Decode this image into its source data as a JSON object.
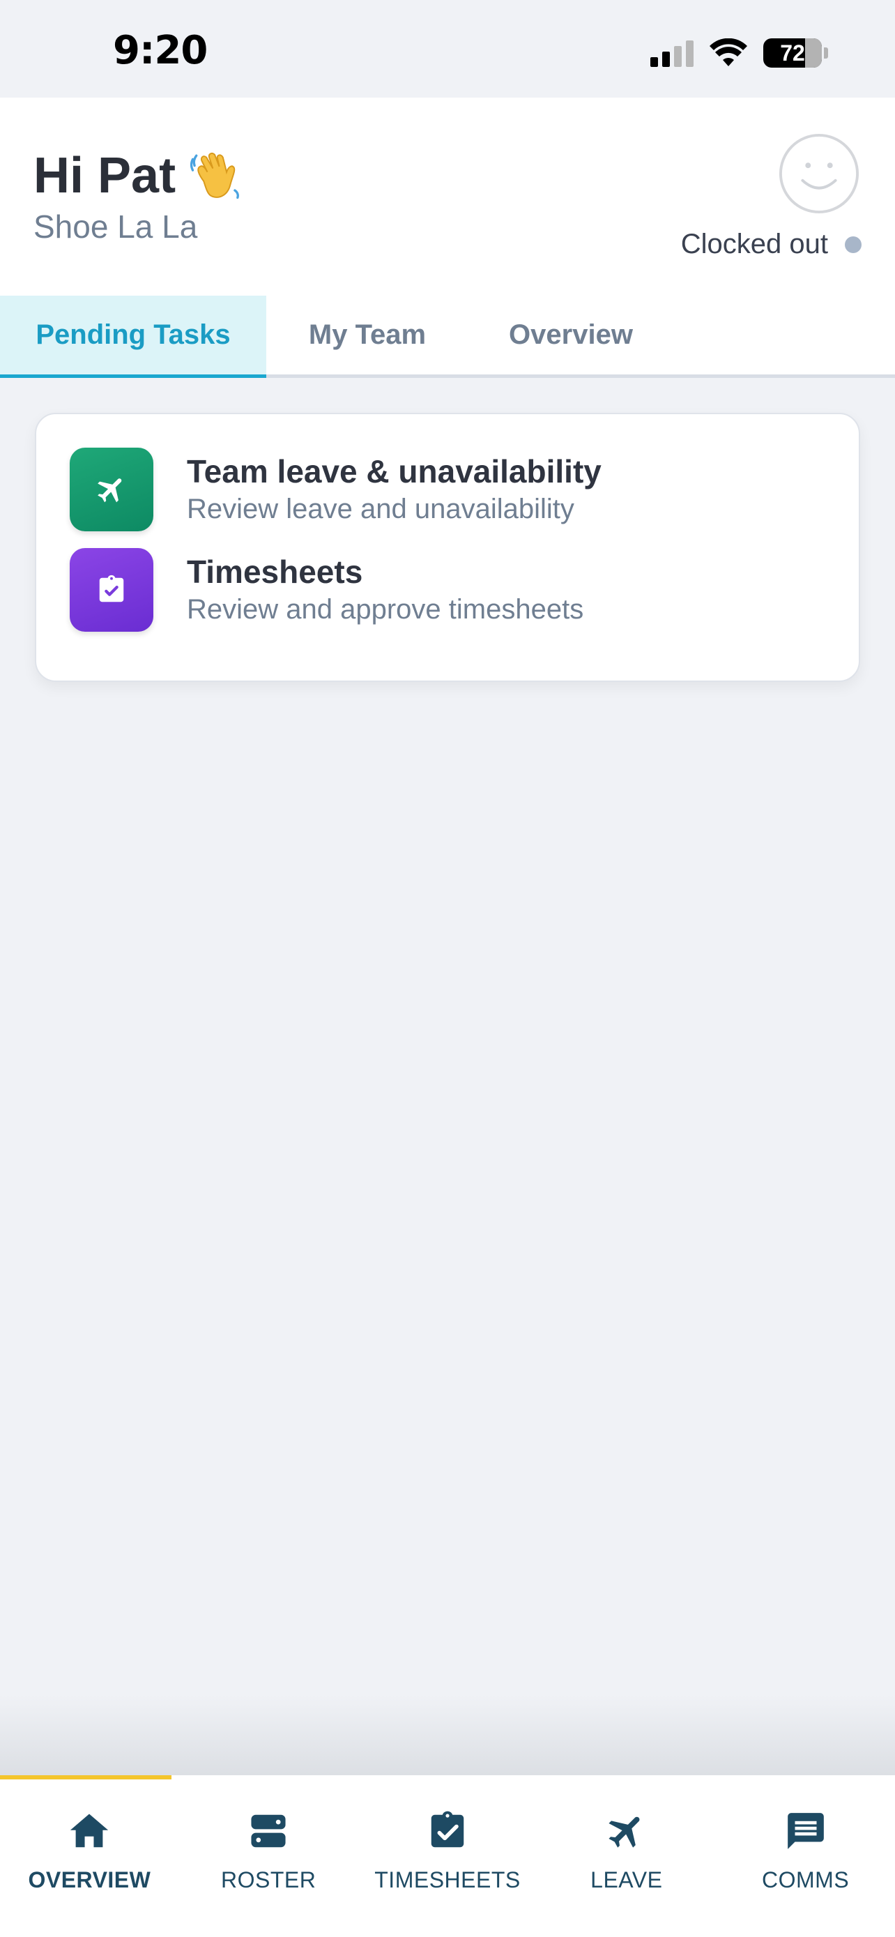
{
  "status_bar": {
    "time": "9:20",
    "battery": "72",
    "icons": [
      "cellular-signal-icon",
      "wifi-icon",
      "battery-icon"
    ]
  },
  "header": {
    "greeting": "Hi Pat",
    "greeting_emoji": "waving-hand-icon",
    "company": "Shoe La La",
    "clock_status": "Clocked out",
    "clock_status_color": "#a8b6c9"
  },
  "tabs": [
    {
      "label": "Pending Tasks",
      "active": true
    },
    {
      "label": "My Team",
      "active": false
    },
    {
      "label": "Overview",
      "active": false
    }
  ],
  "tasks": [
    {
      "title": "Team leave & unavailability",
      "subtitle": "Review leave and unavailability",
      "icon": "airplane-icon",
      "color": "#149a6e"
    },
    {
      "title": "Timesheets",
      "subtitle": "Review and approve timesheets",
      "icon": "clipboard-check-icon",
      "color": "#7a3bdc"
    }
  ],
  "bottom_nav": [
    {
      "label": "OVERVIEW",
      "icon": "home-icon",
      "active": true
    },
    {
      "label": "ROSTER",
      "icon": "roster-icon",
      "active": false
    },
    {
      "label": "TIMESHEETS",
      "icon": "clipboard-check-icon",
      "active": false
    },
    {
      "label": "LEAVE",
      "icon": "airplane-icon",
      "active": false
    },
    {
      "label": "COMMS",
      "icon": "message-icon",
      "active": false
    }
  ],
  "colors": {
    "accent": "#1a9cc4",
    "nav_active_indicator": "#f4c52c",
    "nav_icon": "#1e4a63"
  }
}
